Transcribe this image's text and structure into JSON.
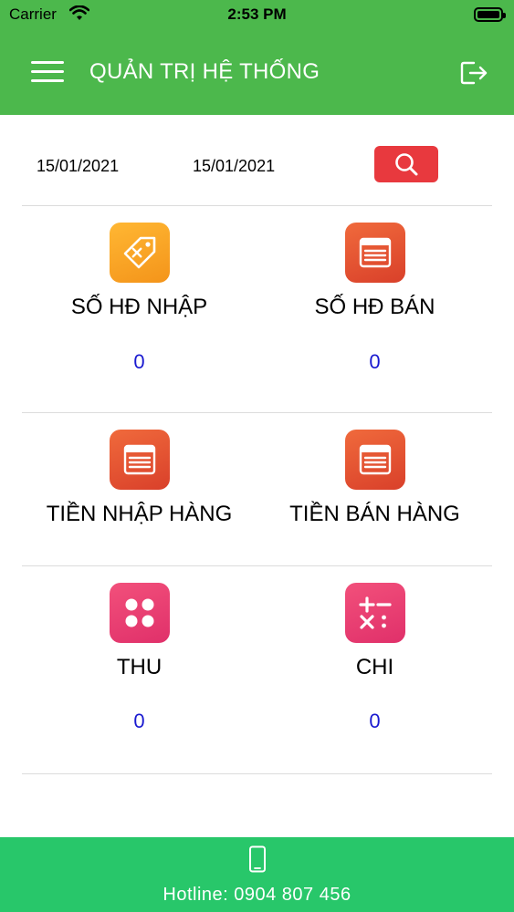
{
  "status_bar": {
    "carrier": "Carrier",
    "time": "2:53 PM"
  },
  "nav": {
    "title": "QUẢN TRỊ HỆ THỐNG"
  },
  "filter": {
    "date_from": "15/01/2021",
    "date_to": "15/01/2021"
  },
  "stats": [
    {
      "label": "SỐ HĐ NHẬP",
      "value": "0",
      "icon": "tag-icon",
      "color": "#f7a224"
    },
    {
      "label": "SỐ HĐ BÁN",
      "value": "0",
      "icon": "invoice-icon",
      "color": "#e14f30"
    },
    {
      "label": "TIỀN NHẬP HÀNG",
      "value": "",
      "icon": "invoice-icon",
      "color": "#e14f30"
    },
    {
      "label": "TIỀN BÁN HÀNG",
      "value": "",
      "icon": "invoice-icon",
      "color": "#e14f30"
    },
    {
      "label": "THU",
      "value": "0",
      "icon": "grid-icon",
      "color": "#e83e72"
    },
    {
      "label": "CHI",
      "value": "0",
      "icon": "calculator-icon",
      "color": "#e83e72"
    }
  ],
  "footer": {
    "hotline": "Hotline: 0904 807 456"
  }
}
